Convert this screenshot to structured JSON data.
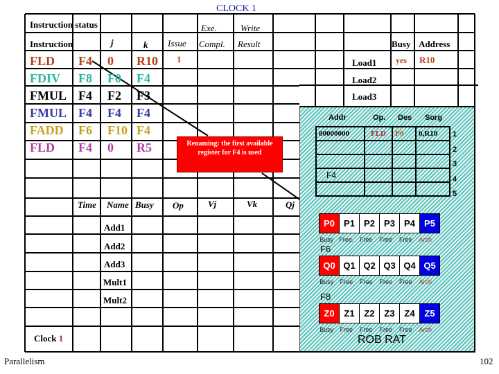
{
  "title": "CLOCK 1",
  "instruction_status": {
    "heading": "Instruction status",
    "headers": {
      "instruction": "Instruction",
      "j": "j",
      "k": "k",
      "issue": "Issue",
      "exe_top": "Exe.",
      "exe": "Compl.",
      "write_top": "Write",
      "write": "Result"
    },
    "rows": [
      {
        "op": "FLD",
        "dest": "F4",
        "j": "0",
        "k": "R10",
        "issue": "1",
        "color": "#b5401a"
      },
      {
        "op": "FDIV",
        "dest": "F8",
        "j": "F0",
        "k": "F4",
        "issue": "",
        "color": "#2ab8a0"
      },
      {
        "op": "FMUL",
        "dest": "F4",
        "j": "F2",
        "k": "F3",
        "issue": "",
        "color": "#000000"
      },
      {
        "op": "FMUL",
        "dest": "F4",
        "j": "F4",
        "k": "F4",
        "issue": "",
        "color": "#3a3aa8"
      },
      {
        "op": "FADD",
        "dest": "F6",
        "j": "F10",
        "k": "F4",
        "issue": "",
        "color": "#c8a020"
      },
      {
        "op": "FLD",
        "dest": "F4",
        "j": "0",
        "k": "R5",
        "issue": "",
        "color": "#b040a0"
      }
    ]
  },
  "load_buffers": {
    "headers": {
      "busy": "Busy",
      "address": "Address"
    },
    "rows": [
      {
        "name": "Load1",
        "busy": "yes",
        "address": "R10"
      },
      {
        "name": "Load2",
        "busy": "",
        "address": ""
      },
      {
        "name": "Load3",
        "busy": "",
        "address": ""
      }
    ]
  },
  "reservation_stations": {
    "headers": [
      "Time",
      "Name",
      "Busy",
      "Op",
      "Vj",
      "Vk",
      "Qj"
    ],
    "rows": [
      "Add1",
      "Add2",
      "Add3",
      "Mult1",
      "Mult2"
    ]
  },
  "clock": {
    "label": "Clock",
    "value": "1"
  },
  "note": "Renaming: the first available register for F4 is used",
  "rob": {
    "headers": [
      "Addr",
      "Op.",
      "Des",
      "Sorg"
    ],
    "rows": [
      {
        "addr": "80000000",
        "op": "FLD",
        "des": "P0",
        "sorg": "0,R10"
      },
      {},
      {},
      {},
      {}
    ],
    "row_numbers": [
      "1",
      "2",
      "3",
      "4",
      "5"
    ]
  },
  "rat": {
    "groups": [
      {
        "label": "F4",
        "regs": [
          "P0",
          "P1",
          "P2",
          "P3",
          "P4",
          "P5"
        ],
        "status": [
          "Busy",
          "Free.",
          "Free",
          "Free",
          "Free",
          "Arch"
        ]
      },
      {
        "label": "F6",
        "regs": [
          "Q0",
          "Q1",
          "Q2",
          "Q3",
          "Q4",
          "Q5"
        ],
        "status": [
          "Busy",
          "Free",
          "Free",
          "Free",
          "Free",
          "Arch"
        ]
      },
      {
        "label": "F8",
        "regs": [
          "Z0",
          "Z1",
          "Z2",
          "Z3",
          "Z4",
          "Z5"
        ],
        "status": [
          "Busy",
          "Free",
          "Free",
          "Free",
          "Free",
          "Arch"
        ]
      }
    ],
    "footer": "ROB RAT"
  },
  "footer": {
    "left": "Parallelism",
    "page": "102"
  }
}
